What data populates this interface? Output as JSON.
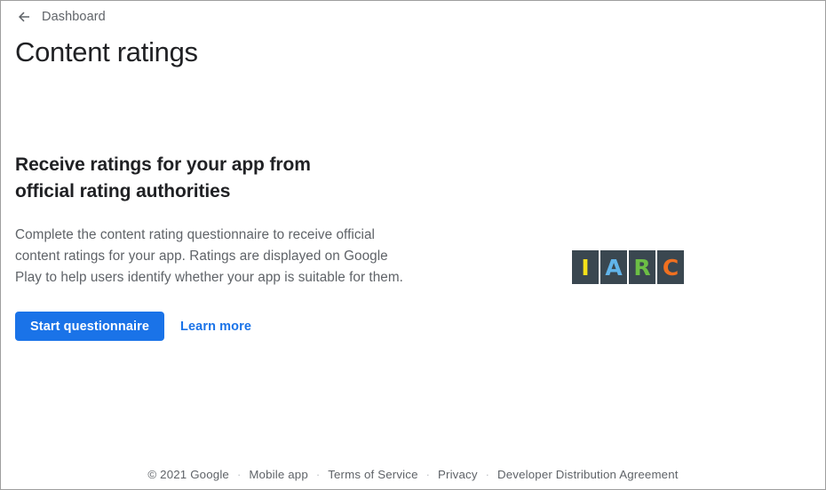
{
  "window": {
    "border_color": "#9e9e9e",
    "background": "#ffffff"
  },
  "back_nav": {
    "icon": "arrow-left-icon",
    "label": "Dashboard"
  },
  "header": {
    "title": "Content ratings"
  },
  "main": {
    "heading": "Receive ratings for your app from official rating authorities",
    "body": "Complete the content rating questionnaire to receive official content ratings for your app. Ratings are displayed on Google Play to help users identify whether your app is suitable for them.",
    "primary_button": {
      "label": "Start questionnaire",
      "color": "#1a73e8",
      "text_color": "#ffffff"
    },
    "secondary_link": {
      "label": "Learn more",
      "color": "#1a73e8"
    }
  },
  "logo": {
    "name": "iarc-logo",
    "tile_background": "#3a4750",
    "letters": [
      {
        "char": "I",
        "color": "#f5e119"
      },
      {
        "char": "A",
        "color": "#61b4ea"
      },
      {
        "char": "R",
        "color": "#6cbe45"
      },
      {
        "char": "C",
        "color": "#f07020"
      }
    ]
  },
  "footer": {
    "separator": "·",
    "separator_color": "#bdc1c6",
    "text_color": "#5f6368",
    "items": [
      {
        "label": "© 2021 Google",
        "is_link": false
      },
      {
        "label": "Mobile app",
        "is_link": true
      },
      {
        "label": "Terms of Service",
        "is_link": true
      },
      {
        "label": "Privacy",
        "is_link": true
      },
      {
        "label": "Developer Distribution Agreement",
        "is_link": true
      }
    ]
  }
}
